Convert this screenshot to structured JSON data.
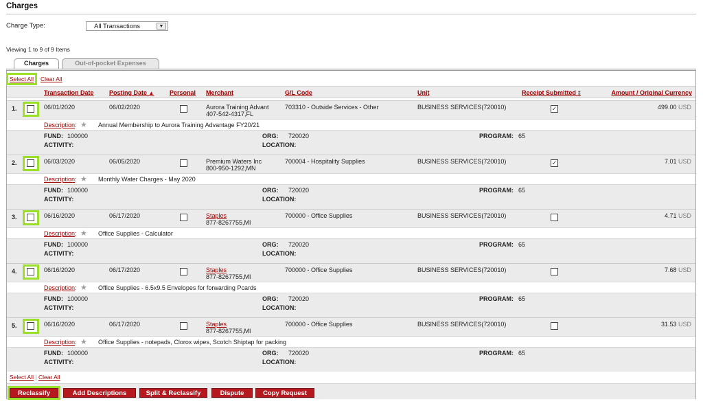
{
  "page": {
    "title": "Charges"
  },
  "filter": {
    "label": "Charge Type:",
    "value": "All Transactions"
  },
  "viewing": "Viewing 1 to 9 of 9 Items",
  "tabs": [
    {
      "label": "Charges",
      "active": true
    },
    {
      "label": "Out-of-pocket Expenses",
      "active": false
    }
  ],
  "selection": {
    "select_all": "Select All",
    "clear_all": "Clear All",
    "separator": "|"
  },
  "columns": {
    "transaction_date": "Transaction Date",
    "posting_date": "Posting Date",
    "personal": "Personal",
    "merchant": "Merchant",
    "gl_code": "G/L Code",
    "unit": "Unit",
    "receipt": "Receipt Submitted",
    "amount": "Amount / Original Currency"
  },
  "sort": {
    "posting_asc_glyph": "▲",
    "receipt_glyph": "‡"
  },
  "labels": {
    "description": "Description",
    "colon": ":",
    "star": "★",
    "fund": "FUND:",
    "activity": "ACTIVITY:",
    "org": "ORG:",
    "location": "LOCATION:",
    "program": "PROGRAM:"
  },
  "records": [
    {
      "num": "1.",
      "transaction_date": "06/01/2020",
      "posting_date": "06/02/2020",
      "personal_checked": false,
      "merchant_line1": "Aurora Training Advant",
      "merchant_line2": "407-542-4317,FL",
      "merchant_link": false,
      "gl_code": "703310 - Outside Services - Other",
      "unit": "BUSINESS SERVICES(720010)",
      "receipt_checked": true,
      "amount": "499.00",
      "currency": "USD",
      "description": "Annual Membership to Aurora Training Advantage FY20/21",
      "fund": "100000",
      "org": "720020",
      "program": "65"
    },
    {
      "num": "2.",
      "transaction_date": "06/03/2020",
      "posting_date": "06/05/2020",
      "personal_checked": false,
      "merchant_line1": "Premium Waters Inc",
      "merchant_line2": "800-950-1292,MN",
      "merchant_link": false,
      "gl_code": "700004 - Hospitality Supplies",
      "unit": "BUSINESS SERVICES(720010)",
      "receipt_checked": true,
      "amount": "7.01",
      "currency": "USD",
      "description": "Monthly Water Charges - May 2020",
      "fund": "100000",
      "org": "720020",
      "program": "65"
    },
    {
      "num": "3.",
      "transaction_date": "06/16/2020",
      "posting_date": "06/17/2020",
      "personal_checked": false,
      "merchant_line1": "Staples",
      "merchant_line2": "877-8267755,MI",
      "merchant_link": true,
      "gl_code": "700000 - Office Supplies",
      "unit": "BUSINESS SERVICES(720010)",
      "receipt_checked": false,
      "amount": "4.71",
      "currency": "USD",
      "description": "Office Supplies - Calculator",
      "fund": "100000",
      "org": "720020",
      "program": "65"
    },
    {
      "num": "4.",
      "transaction_date": "06/16/2020",
      "posting_date": "06/17/2020",
      "personal_checked": false,
      "merchant_line1": "Staples",
      "merchant_line2": "877-8267755,MI",
      "merchant_link": true,
      "gl_code": "700000 - Office Supplies",
      "unit": "BUSINESS SERVICES(720010)",
      "receipt_checked": false,
      "amount": "7.68",
      "currency": "USD",
      "description": "Office Supplies - 6.5x9.5 Envelopes for forwarding Pcards",
      "fund": "100000",
      "org": "720020",
      "program": "65"
    },
    {
      "num": "5.",
      "transaction_date": "06/16/2020",
      "posting_date": "06/17/2020",
      "personal_checked": false,
      "merchant_line1": "Staples",
      "merchant_line2": "877-8267755,MI",
      "merchant_link": true,
      "gl_code": "700000 - Office Supplies",
      "unit": "BUSINESS SERVICES(720010)",
      "receipt_checked": false,
      "amount": "31.53",
      "currency": "USD",
      "description": "Office Supplies - notepads, Clorox wipes, Scotch Shiptap for packing",
      "fund": "100000",
      "org": "720020",
      "program": "65"
    }
  ],
  "buttons": {
    "reclassify": "Reclassify",
    "add_descriptions": "Add Descriptions",
    "split_reclassify": "Split & Reclassify",
    "dispute": "Dispute",
    "copy_request": "Copy Request"
  },
  "colors": {
    "accent": "#a00000",
    "button": "#b5191f",
    "highlight": "#9ae02b"
  }
}
